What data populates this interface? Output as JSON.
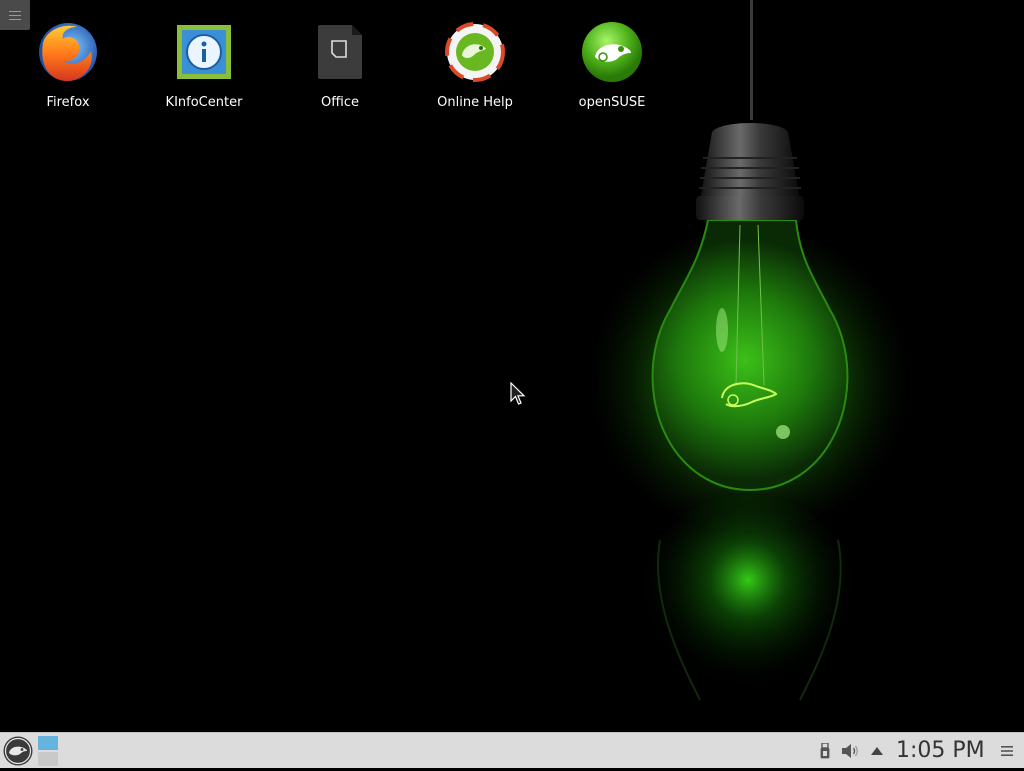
{
  "desktop": {
    "icons": [
      {
        "label": "Firefox",
        "icon": "firefox-icon"
      },
      {
        "label": "KInfoCenter",
        "icon": "info-icon"
      },
      {
        "label": "Office",
        "icon": "document-icon"
      },
      {
        "label": "Online Help",
        "icon": "help-lifebuoy-icon"
      },
      {
        "label": "openSUSE",
        "icon": "opensuse-gecko-icon"
      }
    ]
  },
  "taskbar": {
    "clock": "1:05 PM",
    "tray_icons": [
      "usb-device-icon",
      "volume-icon",
      "expand-arrow-icon"
    ],
    "accent": "#66b3e0"
  },
  "wallpaper": {
    "description_colors": {
      "glow": "#39ff14",
      "background": "#000000"
    }
  }
}
